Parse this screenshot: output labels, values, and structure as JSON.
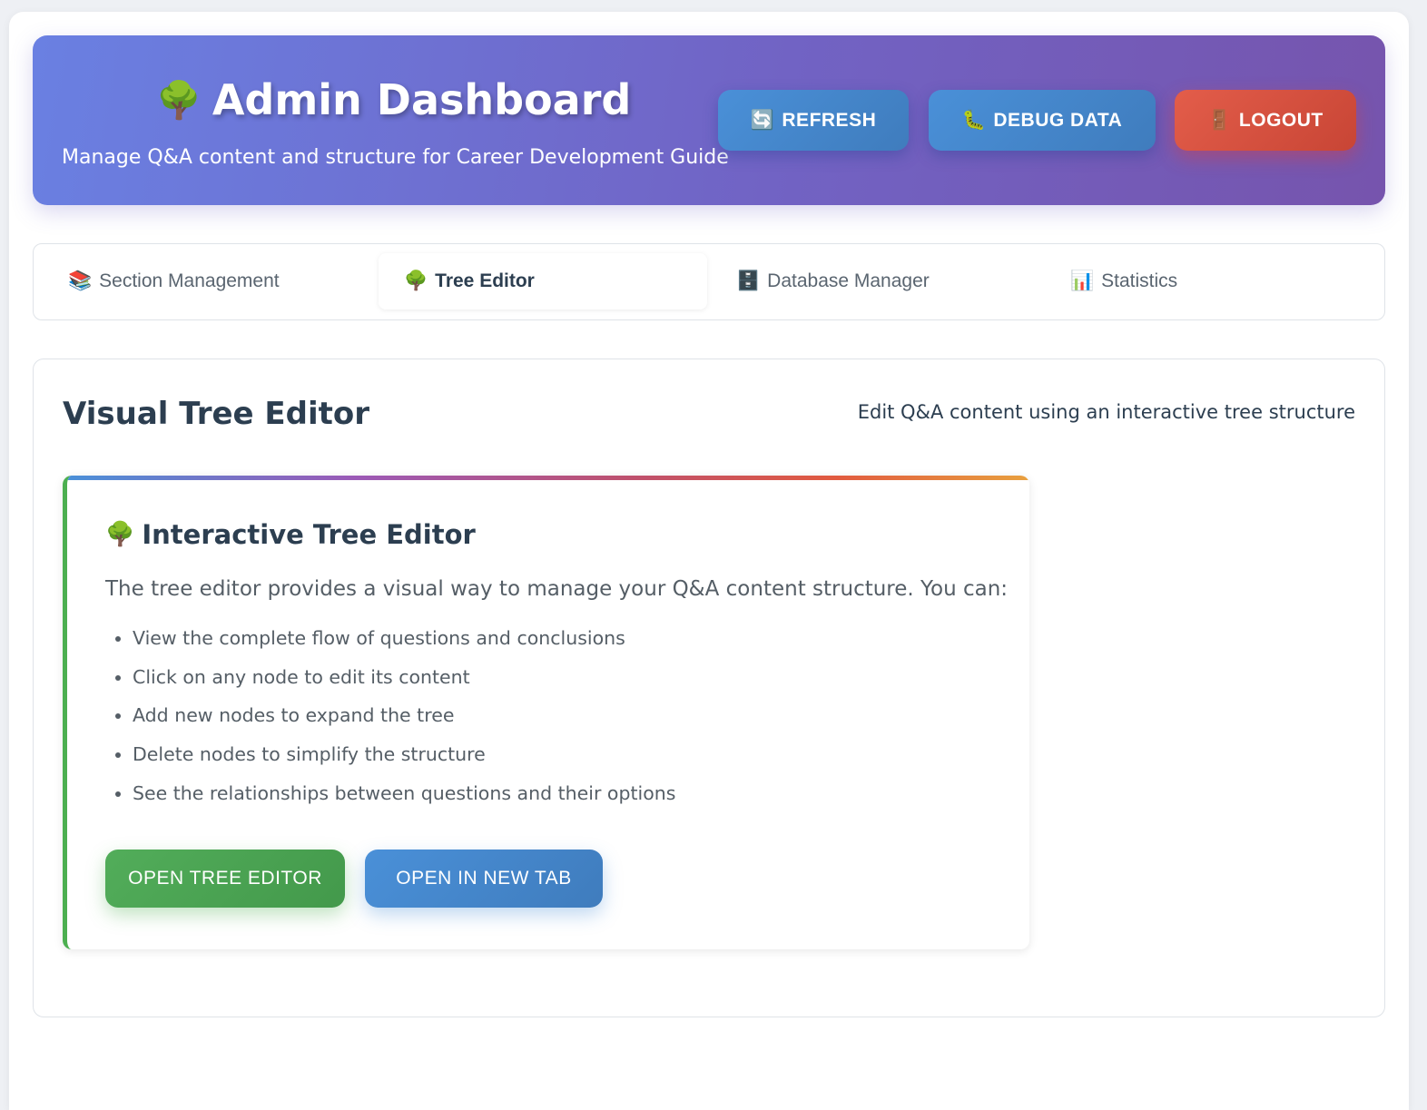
{
  "header": {
    "title_icon": "🌳",
    "title": "Admin Dashboard",
    "subtitle": "Manage Q&A content and structure for Career Development Guide",
    "buttons": {
      "refresh": {
        "icon": "🔄",
        "label": "REFRESH"
      },
      "debug": {
        "icon": "🐛",
        "label": "DEBUG DATA"
      },
      "logout": {
        "icon": "🚪",
        "label": "LOGOUT"
      }
    }
  },
  "tabs": [
    {
      "icon": "📚",
      "label": "Section Management",
      "active": false
    },
    {
      "icon": "🌳",
      "label": "Tree Editor",
      "active": true
    },
    {
      "icon": "🗄️",
      "label": "Database Manager",
      "active": false
    },
    {
      "icon": "📊",
      "label": "Statistics",
      "active": false
    }
  ],
  "panel": {
    "title": "Visual Tree Editor",
    "description": "Edit Q&A content using an interactive tree structure"
  },
  "card": {
    "title_icon": "🌳",
    "title": "Interactive Tree Editor",
    "intro": "The tree editor provides a visual way to manage your Q&A content structure. You can:",
    "items": [
      "View the complete flow of questions and conclusions",
      "Click on any node to edit its content",
      "Add new nodes to expand the tree",
      "Delete nodes to simplify the structure",
      "See the relationships between questions and their options"
    ],
    "buttons": {
      "open": "OPEN TREE EDITOR",
      "new_tab": "OPEN IN NEW TAB"
    }
  },
  "colors": {
    "header_gradient_start": "#6a80e2",
    "header_gradient_end": "#7654ad",
    "primary_blue": "#4a90d8",
    "danger_red": "#e35d4a",
    "success_green": "#4caf50",
    "text_dark": "#2c3e50"
  }
}
